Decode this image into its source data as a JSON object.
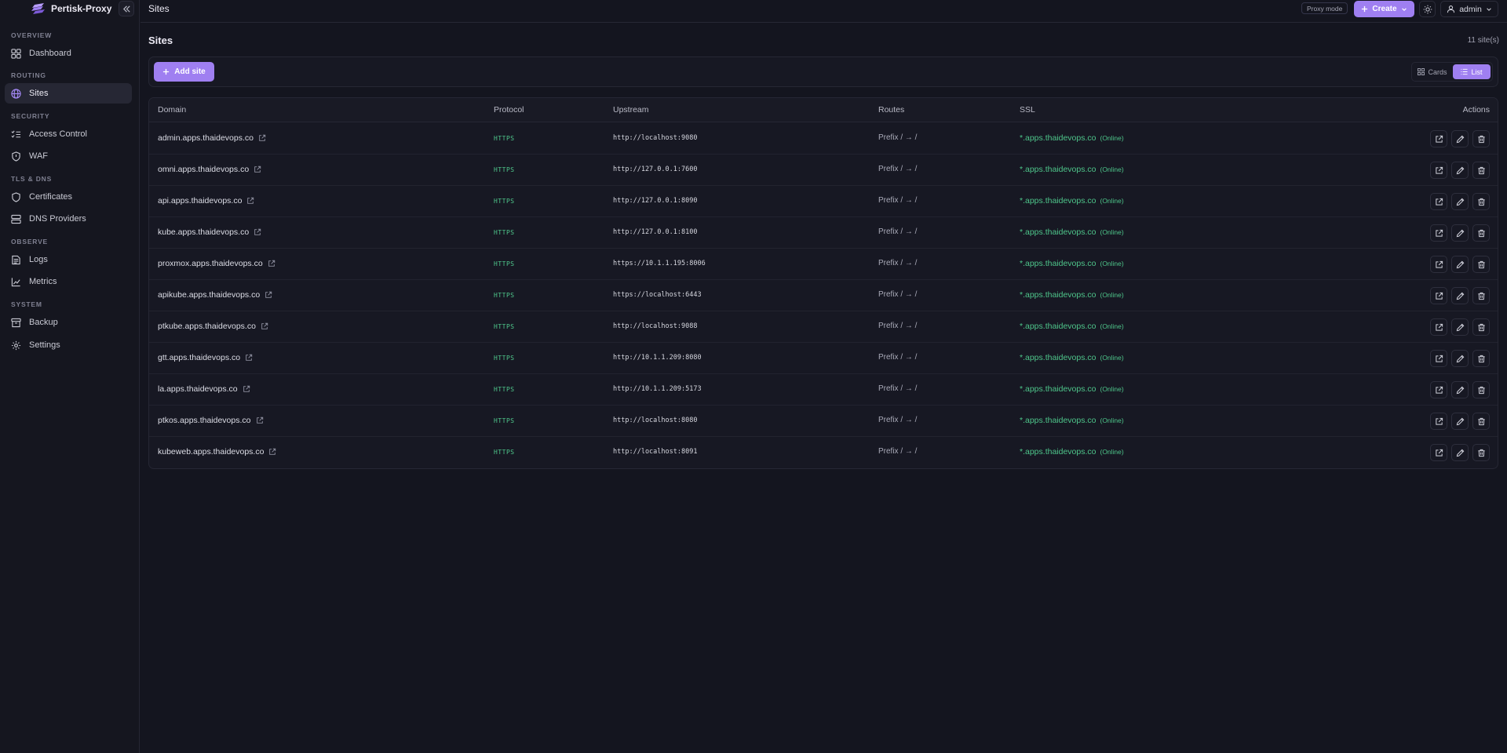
{
  "app": {
    "name": "Pertisk-Proxy",
    "colors": {
      "accent": "#9f7ff1",
      "success": "#4ec58a",
      "background": "#14151f"
    }
  },
  "sidebar": {
    "collapse_icon": "chevrons-left-icon",
    "sections": [
      {
        "label": "OVERVIEW",
        "items": [
          {
            "label": "Dashboard",
            "icon": "dashboard-icon",
            "active": false
          }
        ]
      },
      {
        "label": "ROUTING",
        "items": [
          {
            "label": "Sites",
            "icon": "globe-icon",
            "active": true
          }
        ]
      },
      {
        "label": "SECURITY",
        "items": [
          {
            "label": "Access Control",
            "icon": "list-checks-icon",
            "active": false
          },
          {
            "label": "WAF",
            "icon": "shield-icon",
            "active": false
          }
        ]
      },
      {
        "label": "TLS & DNS",
        "items": [
          {
            "label": "Certificates",
            "icon": "shield-icon",
            "active": false
          },
          {
            "label": "DNS Providers",
            "icon": "server-icon",
            "active": false
          }
        ]
      },
      {
        "label": "OBSERVE",
        "items": [
          {
            "label": "Logs",
            "icon": "logs-icon",
            "active": false
          },
          {
            "label": "Metrics",
            "icon": "chart-line-icon",
            "active": false
          }
        ]
      },
      {
        "label": "SYSTEM",
        "items": [
          {
            "label": "Backup",
            "icon": "archive-icon",
            "active": false
          },
          {
            "label": "Settings",
            "icon": "gear-icon",
            "active": false
          }
        ]
      }
    ]
  },
  "topbar": {
    "title": "Sites",
    "mode_badge": "Proxy mode",
    "create_label": "Create",
    "theme_icon": "sun-icon",
    "user_label": "admin"
  },
  "main": {
    "heading": "Sites",
    "count": "11 site(s)",
    "add_label": "Add site",
    "view_options": [
      {
        "label": "Cards",
        "active": false
      },
      {
        "label": "List",
        "active": true
      }
    ]
  },
  "table": {
    "headers": {
      "domain": "Domain",
      "protocol": "Protocol",
      "upstream": "Upstream",
      "routes": "Routes",
      "ssl": "SSL",
      "actions": "Actions"
    },
    "rows": [
      {
        "domain": "admin.apps.thaidevops.co",
        "protocol": "HTTPS",
        "upstream": "http://localhost:9080",
        "routes": "Prefix / → /",
        "ssl": "*.apps.thaidevops.co",
        "ssl_status": "(Online)"
      },
      {
        "domain": "omni.apps.thaidevops.co",
        "protocol": "HTTPS",
        "upstream": "http://127.0.0.1:7600",
        "routes": "Prefix / → /",
        "ssl": "*.apps.thaidevops.co",
        "ssl_status": "(Online)"
      },
      {
        "domain": "api.apps.thaidevops.co",
        "protocol": "HTTPS",
        "upstream": "http://127.0.0.1:8090",
        "routes": "Prefix / → /",
        "ssl": "*.apps.thaidevops.co",
        "ssl_status": "(Online)"
      },
      {
        "domain": "kube.apps.thaidevops.co",
        "protocol": "HTTPS",
        "upstream": "http://127.0.0.1:8100",
        "routes": "Prefix / → /",
        "ssl": "*.apps.thaidevops.co",
        "ssl_status": "(Online)"
      },
      {
        "domain": "proxmox.apps.thaidevops.co",
        "protocol": "HTTPS",
        "upstream": "https://10.1.1.195:8006",
        "routes": "Prefix / → /",
        "ssl": "*.apps.thaidevops.co",
        "ssl_status": "(Online)"
      },
      {
        "domain": "apikube.apps.thaidevops.co",
        "protocol": "HTTPS",
        "upstream": "https://localhost:6443",
        "routes": "Prefix / → /",
        "ssl": "*.apps.thaidevops.co",
        "ssl_status": "(Online)"
      },
      {
        "domain": "ptkube.apps.thaidevops.co",
        "protocol": "HTTPS",
        "upstream": "http://localhost:9088",
        "routes": "Prefix / → /",
        "ssl": "*.apps.thaidevops.co",
        "ssl_status": "(Online)"
      },
      {
        "domain": "gtt.apps.thaidevops.co",
        "protocol": "HTTPS",
        "upstream": "http://10.1.1.209:8080",
        "routes": "Prefix / → /",
        "ssl": "*.apps.thaidevops.co",
        "ssl_status": "(Online)"
      },
      {
        "domain": "la.apps.thaidevops.co",
        "protocol": "HTTPS",
        "upstream": "http://10.1.1.209:5173",
        "routes": "Prefix / → /",
        "ssl": "*.apps.thaidevops.co",
        "ssl_status": "(Online)"
      },
      {
        "domain": "ptkos.apps.thaidevops.co",
        "protocol": "HTTPS",
        "upstream": "http://localhost:8080",
        "routes": "Prefix / → /",
        "ssl": "*.apps.thaidevops.co",
        "ssl_status": "(Online)"
      },
      {
        "domain": "kubeweb.apps.thaidevops.co",
        "protocol": "HTTPS",
        "upstream": "http://localhost:8091",
        "routes": "Prefix / → /",
        "ssl": "*.apps.thaidevops.co",
        "ssl_status": "(Online)"
      }
    ]
  }
}
